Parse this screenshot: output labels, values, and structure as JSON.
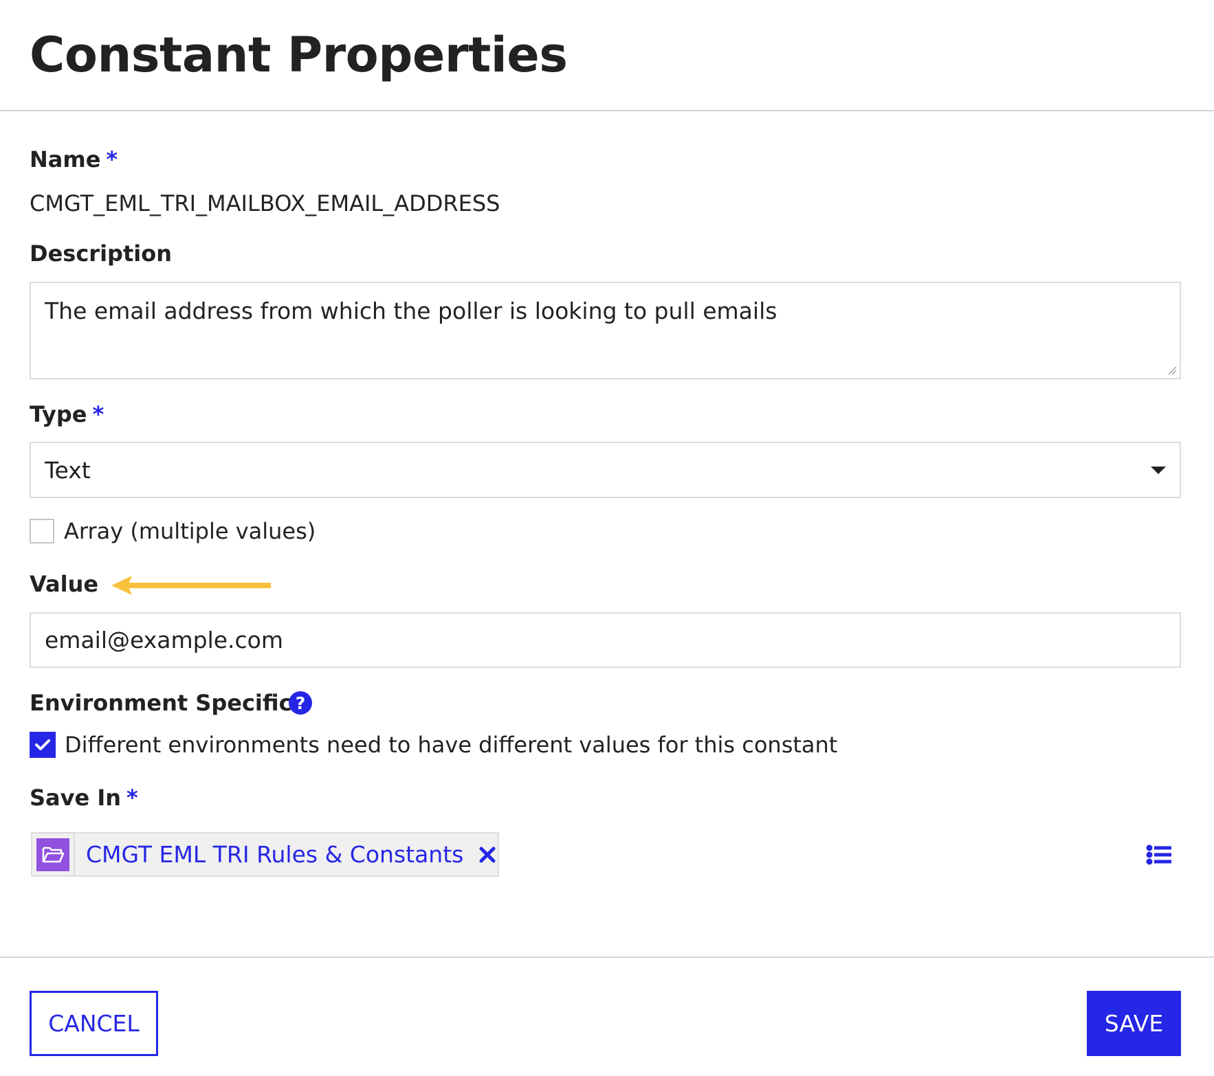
{
  "header": {
    "title": "Constant Properties"
  },
  "form": {
    "name": {
      "label": "Name",
      "required_marker": "*",
      "value": "CMGT_EML_TRI_MAILBOX_EMAIL_ADDRESS"
    },
    "description": {
      "label": "Description",
      "value": "The email address from which the poller is looking to pull emails"
    },
    "type": {
      "label": "Type",
      "required_marker": "*",
      "selected": "Text"
    },
    "array": {
      "label": "Array (multiple values)",
      "checked": false
    },
    "value": {
      "label": "Value",
      "value": "email@example.com",
      "annotation_arrow_color": "#f8c03c"
    },
    "environment_specific": {
      "label": "Environment Specific",
      "help_glyph": "?",
      "checkbox_label": "Different environments need to have different values for this constant",
      "checked": true
    },
    "save_in": {
      "label": "Save In",
      "required_marker": "*",
      "chip_label": "CMGT EML TRI Rules & Constants",
      "chip_icon": "folder-open-icon",
      "browse_icon": "list-icon"
    }
  },
  "footer": {
    "cancel_label": "CANCEL",
    "save_label": "SAVE"
  },
  "colors": {
    "accent": "#2626e6",
    "folder": "#9150df",
    "border": "#dcdcdc",
    "arrow": "#f8c03c"
  }
}
